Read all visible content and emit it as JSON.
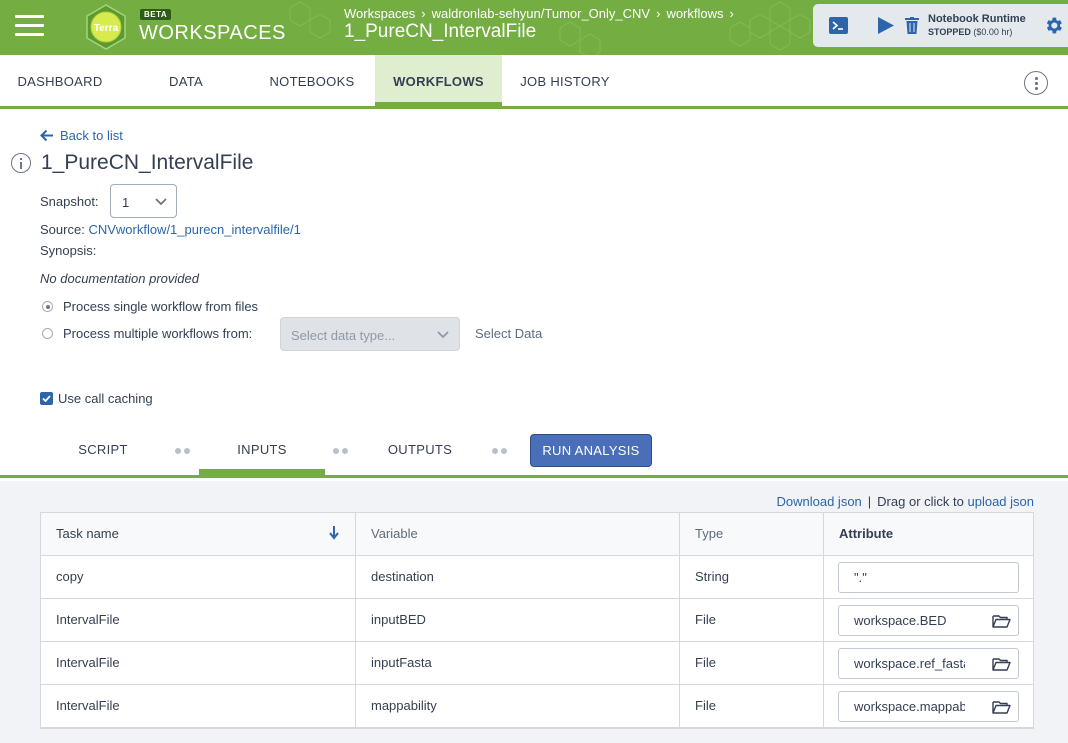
{
  "header": {
    "brand": "WORKSPACES",
    "beta_badge": "BETA",
    "logo_text": "Terra",
    "breadcrumbs": [
      "Workspaces",
      "waldronlab-sehyun/Tumor_Only_CNV",
      "workflows"
    ],
    "breadcrumb_separator": "›",
    "title": "1_PureCN_IntervalFile",
    "runtime": {
      "title": "Notebook Runtime",
      "status": "STOPPED",
      "cost": "($0.00 hr)"
    },
    "icons": [
      "menu-icon",
      "terminal-icon",
      "play-icon",
      "trash-icon",
      "gear-icon"
    ]
  },
  "nav": {
    "tabs": [
      "DASHBOARD",
      "DATA",
      "NOTEBOOKS",
      "WORKFLOWS",
      "JOB HISTORY"
    ],
    "active": "WORKFLOWS"
  },
  "workflow": {
    "back_label": "Back to list",
    "title": "1_PureCN_IntervalFile",
    "snapshot_label": "Snapshot:",
    "snapshot_value": "1",
    "source_label": "Source:",
    "source_link": "CNVworkflow/1_purecn_intervalfile/1",
    "synopsis_label": "Synopsis:",
    "no_docs": "No documentation provided",
    "radio_single": "Process single workflow from files",
    "radio_multiple": "Process multiple workflows from:",
    "data_type_placeholder": "Select data type...",
    "select_data": "Select Data",
    "call_caching": "Use call caching",
    "call_caching_checked": true,
    "selected_mode": "single"
  },
  "subtabs": {
    "script": "SCRIPT",
    "inputs": "INPUTS",
    "outputs": "OUTPUTS",
    "run": "RUN ANALYSIS",
    "active": "INPUTS"
  },
  "inputs": {
    "download_json": "Download json",
    "separator": "|",
    "upload_prefix": "Drag or click to",
    "upload_json": "upload json",
    "columns": [
      "Task name",
      "Variable",
      "Type",
      "Attribute"
    ],
    "rows": [
      {
        "task": "copy",
        "variable": "destination",
        "type": "String",
        "attribute": "\".\"",
        "browse": false
      },
      {
        "task": "IntervalFile",
        "variable": "inputBED",
        "type": "File",
        "attribute": "workspace.BED",
        "browse": true
      },
      {
        "task": "IntervalFile",
        "variable": "inputFasta",
        "type": "File",
        "attribute": "workspace.ref_fasta",
        "browse": true
      },
      {
        "task": "IntervalFile",
        "variable": "mappability",
        "type": "File",
        "attribute": "workspace.mappability",
        "browse": true
      }
    ]
  },
  "colors": {
    "brand_green": "#74ae43",
    "link_blue": "#2c65a9",
    "button_blue": "#4a6fb8",
    "text": "#333f52"
  }
}
